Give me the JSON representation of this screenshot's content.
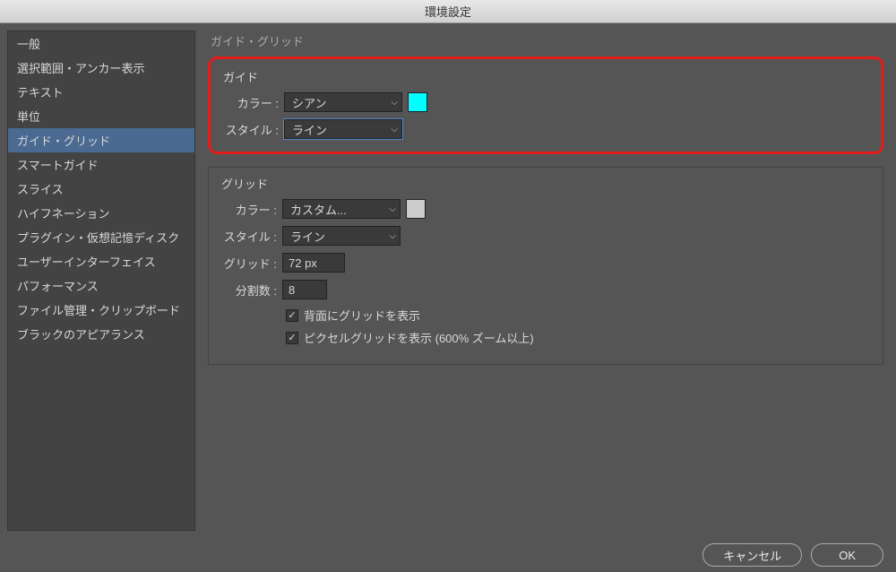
{
  "window": {
    "title": "環境設定"
  },
  "sidebar": {
    "items": [
      {
        "label": "一般"
      },
      {
        "label": "選択範囲・アンカー表示"
      },
      {
        "label": "テキスト"
      },
      {
        "label": "単位"
      },
      {
        "label": "ガイド・グリッド",
        "selected": true
      },
      {
        "label": "スマートガイド"
      },
      {
        "label": "スライス"
      },
      {
        "label": "ハイフネーション"
      },
      {
        "label": "プラグイン・仮想記憶ディスク"
      },
      {
        "label": "ユーザーインターフェイス"
      },
      {
        "label": "パフォーマンス"
      },
      {
        "label": "ファイル管理・クリップボード"
      },
      {
        "label": "ブラックのアピアランス"
      }
    ]
  },
  "main": {
    "title": "ガイド・グリッド",
    "guide": {
      "legend": "ガイド",
      "color_label": "カラー :",
      "color_value": "シアン",
      "color_hex": "#00ffff",
      "style_label": "スタイル :",
      "style_value": "ライン"
    },
    "grid": {
      "legend": "グリッド",
      "color_label": "カラー :",
      "color_value": "カスタム...",
      "color_hex": "#cccccc",
      "style_label": "スタイル :",
      "style_value": "ライン",
      "spacing_label": "グリッド :",
      "spacing_value": "72 px",
      "subdiv_label": "分割数 :",
      "subdiv_value": "8",
      "check1_label": "背面にグリッドを表示",
      "check1_checked": true,
      "check2_label": "ピクセルグリッドを表示 (600% ズーム以上)",
      "check2_checked": true
    }
  },
  "footer": {
    "cancel_label": "キャンセル",
    "ok_label": "OK"
  }
}
